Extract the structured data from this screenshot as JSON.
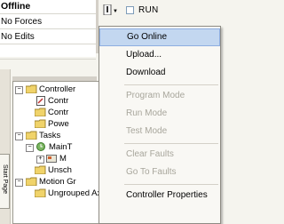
{
  "status": {
    "mode": "Offline",
    "forces": "No Forces",
    "edits": "No Edits"
  },
  "toolbar": {
    "run_label": "RUN",
    "key_icon": "key-icon",
    "dropdown_arrow": "▼"
  },
  "side_tab": {
    "label": "Start Page"
  },
  "tree": {
    "items": [
      {
        "label": "Controller",
        "expander": "−",
        "icon": "folder-icon"
      },
      {
        "label": "Contr",
        "icon": "controller-tags-icon"
      },
      {
        "label": "Contr",
        "icon": "folder-icon"
      },
      {
        "label": "Powe",
        "icon": "folder-icon"
      },
      {
        "label": "Tasks",
        "expander": "−",
        "icon": "folder-icon"
      },
      {
        "label": "MainT",
        "expander": "−",
        "icon": "task-icon"
      },
      {
        "label": "M",
        "expander": "+",
        "icon": "program-icon"
      },
      {
        "label": "Unsch",
        "icon": "folder-icon"
      },
      {
        "label": "Motion Gr",
        "expander": "−",
        "icon": "folder-icon"
      },
      {
        "label": "Ungrouped Axes",
        "icon": "folder-icon"
      }
    ]
  },
  "menu": {
    "items": [
      {
        "label": "Go Online",
        "enabled": true,
        "highlighted": true
      },
      {
        "label": "Upload...",
        "enabled": true
      },
      {
        "label": "Download",
        "enabled": true
      },
      {
        "label": "Program Mode",
        "enabled": false
      },
      {
        "label": "Run Mode",
        "enabled": false
      },
      {
        "label": "Test Mode",
        "enabled": false
      },
      {
        "label": "Clear Faults",
        "enabled": false
      },
      {
        "label": "Go To Faults",
        "enabled": false
      },
      {
        "label": "Controller Properties",
        "enabled": true
      }
    ]
  },
  "colors": {
    "menu_highlight": "#c3d7f0",
    "disabled_text": "#a8a69c",
    "folder": "#f0d36a"
  }
}
